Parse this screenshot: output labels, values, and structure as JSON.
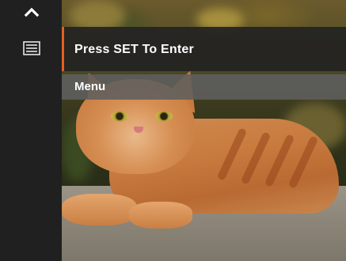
{
  "sidebar": {
    "up_icon": "chevron-up-icon",
    "menu_icon": "menu-list-icon",
    "background": "#202020"
  },
  "menu": {
    "prompt": "Press SET To Enter",
    "section": "Menu",
    "accent_color": "#e4601e"
  },
  "preview": {
    "subject_icon": "cat-photo"
  }
}
